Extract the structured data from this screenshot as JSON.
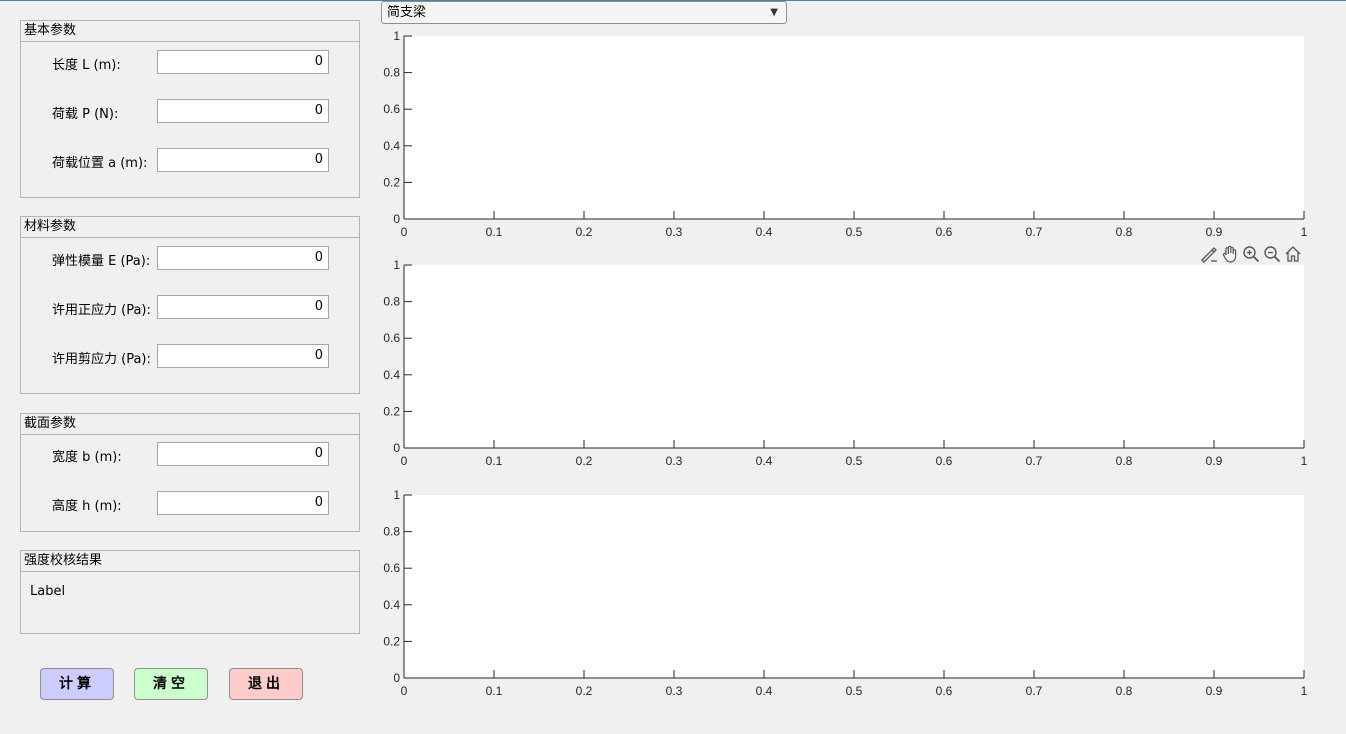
{
  "beam_type": {
    "selected": "简支梁"
  },
  "panels": {
    "basic": {
      "title": "基本参数",
      "fields": [
        {
          "label": "长度 L (m):",
          "value": "0"
        },
        {
          "label": "荷载 P (N):",
          "value": "0"
        },
        {
          "label": "荷载位置 a (m):",
          "value": "0"
        }
      ]
    },
    "material": {
      "title": "材料参数",
      "fields": [
        {
          "label": "弹性模量 E (Pa):",
          "value": "0"
        },
        {
          "label": "许用正应力 (Pa):",
          "value": "0"
        },
        {
          "label": "许用剪应力 (Pa):",
          "value": "0"
        }
      ]
    },
    "section": {
      "title": "截面参数",
      "fields": [
        {
          "label": "宽度 b (m):",
          "value": "0"
        },
        {
          "label": "高度 h (m):",
          "value": "0"
        }
      ]
    },
    "result": {
      "title": "强度校核结果",
      "text": "Label"
    }
  },
  "buttons": {
    "calculate": "计算",
    "clear": "清空",
    "exit": "退出"
  },
  "axes_toolbar": [
    "brush-icon",
    "pan-hand-icon",
    "zoom-in-icon",
    "zoom-out-icon",
    "home-icon"
  ],
  "colors": {
    "calculate_bg": "#ccccff",
    "clear_bg": "#ccffcc",
    "exit_bg": "#ffcccc"
  },
  "chart_data": [
    {
      "type": "line",
      "series": [],
      "xlim": [
        0,
        1
      ],
      "ylim": [
        0,
        1
      ],
      "xticks": [
        "0",
        "0.1",
        "0.2",
        "0.3",
        "0.4",
        "0.5",
        "0.6",
        "0.7",
        "0.8",
        "0.9",
        "1"
      ],
      "yticks": [
        "0",
        "0.2",
        "0.4",
        "0.6",
        "0.8",
        "1"
      ],
      "grid": false
    },
    {
      "type": "line",
      "series": [],
      "xlim": [
        0,
        1
      ],
      "ylim": [
        0,
        1
      ],
      "xticks": [
        "0",
        "0.1",
        "0.2",
        "0.3",
        "0.4",
        "0.5",
        "0.6",
        "0.7",
        "0.8",
        "0.9",
        "1"
      ],
      "yticks": [
        "0",
        "0.2",
        "0.4",
        "0.6",
        "0.8",
        "1"
      ],
      "grid": false
    },
    {
      "type": "line",
      "series": [],
      "xlim": [
        0,
        1
      ],
      "ylim": [
        0,
        1
      ],
      "xticks": [
        "0",
        "0.1",
        "0.2",
        "0.3",
        "0.4",
        "0.5",
        "0.6",
        "0.7",
        "0.8",
        "0.9",
        "1"
      ],
      "yticks": [
        "0",
        "0.2",
        "0.4",
        "0.6",
        "0.8",
        "1"
      ],
      "grid": false
    }
  ]
}
